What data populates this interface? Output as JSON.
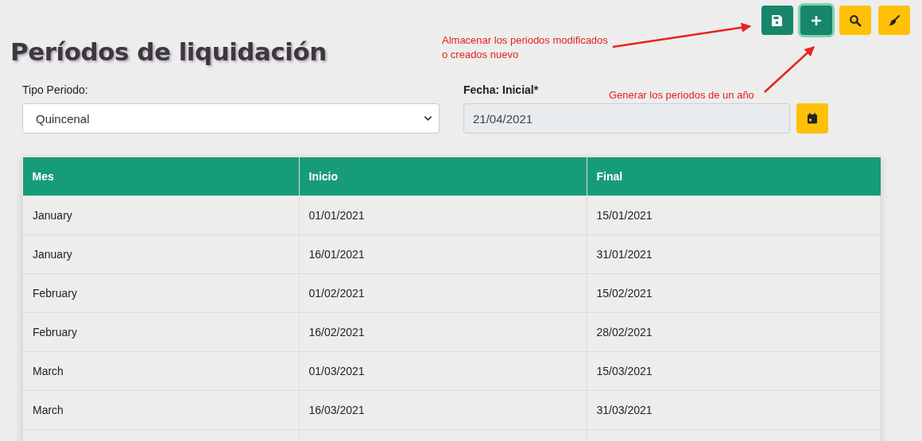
{
  "toolbar": [
    {
      "kind": "save",
      "focused": false
    },
    {
      "kind": "add",
      "focused": true
    },
    {
      "kind": "search",
      "focused": false
    },
    {
      "kind": "clear",
      "focused": false
    }
  ],
  "title": "Períodos de liquidación",
  "form": {
    "period_type": {
      "label": "Tipo Periodo:",
      "value": "Quincenal"
    },
    "start_date": {
      "label": "Fecha: Inicial*",
      "value": "21/04/2021"
    }
  },
  "table": {
    "columns": [
      "Mes",
      "Inicio",
      "Final"
    ],
    "rows": [
      [
        "January",
        "01/01/2021",
        "15/01/2021"
      ],
      [
        "January",
        "16/01/2021",
        "31/01/2021"
      ],
      [
        "February",
        "01/02/2021",
        "15/02/2021"
      ],
      [
        "February",
        "16/02/2021",
        "28/02/2021"
      ],
      [
        "March",
        "01/03/2021",
        "15/03/2021"
      ],
      [
        "March",
        "16/03/2021",
        "31/03/2021"
      ]
    ]
  },
  "annotations": [
    {
      "text": "Almacenar los periodos modificados\no creados nuevo"
    },
    {
      "text": "Generar los periodos de un año"
    }
  ]
}
